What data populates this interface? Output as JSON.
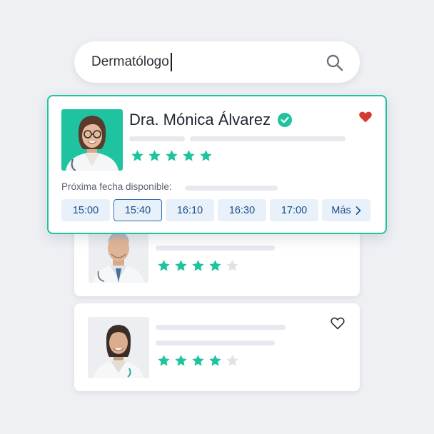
{
  "search": {
    "query": "Dermatólogo",
    "icon": "search-icon"
  },
  "featured_doctor": {
    "name": "Dra. Mónica Álvarez",
    "verified_icon": "check-circle-icon",
    "favorite_icon": "heart-filled-icon",
    "favorited": true,
    "rating": 5,
    "rating_max": 5,
    "next_available_label": "Próxima fecha disponible:",
    "time_slots": [
      "15:00",
      "15:40",
      "16:10",
      "16:30",
      "17:00"
    ],
    "selected_slot": "15:40",
    "more_label": "Más",
    "more_icon": "chevron-right-icon"
  },
  "doctor_list": [
    {
      "rating": 4,
      "rating_max": 5,
      "favorite_icon": "heart-outline-icon"
    },
    {
      "rating": 4,
      "rating_max": 5,
      "favorite_icon": "heart-outline-icon",
      "favorited": false
    }
  ],
  "colors": {
    "accent": "#1fc3a0",
    "star_filled": "#1fc3a0",
    "star_empty": "#dfe2e7",
    "heart_filled": "#d63a2f",
    "slot_bg": "#e8f0fa",
    "slot_text": "#1d4f8c",
    "slot_selected_border": "#2f6db3"
  }
}
